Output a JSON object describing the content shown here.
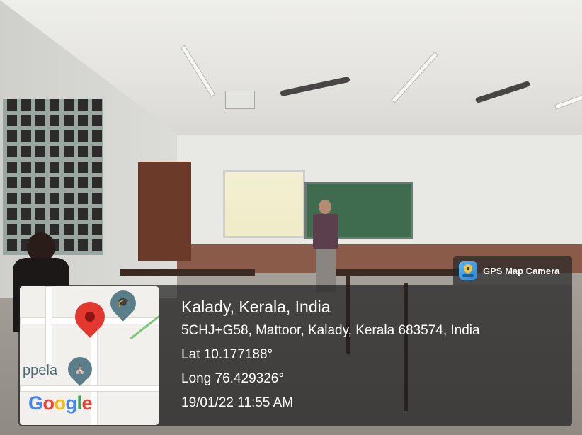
{
  "overlay": {
    "brand_label": "GPS Map Camera",
    "location_title": "Kalady, Kerala, India",
    "address": "5CHJ+G58, Mattoor, Kalady, Kerala 683574, India",
    "latitude": "Lat 10.177188°",
    "longitude": "Long 76.429326°",
    "datetime": "19/01/22 11:55 AM"
  },
  "map": {
    "place_label": "ppela",
    "logo_text": "Google",
    "pin_color": "#e2382f"
  },
  "icons": [
    "location-pin-icon",
    "school-icon",
    "temple-icon",
    "gps-map-camera-icon"
  ]
}
